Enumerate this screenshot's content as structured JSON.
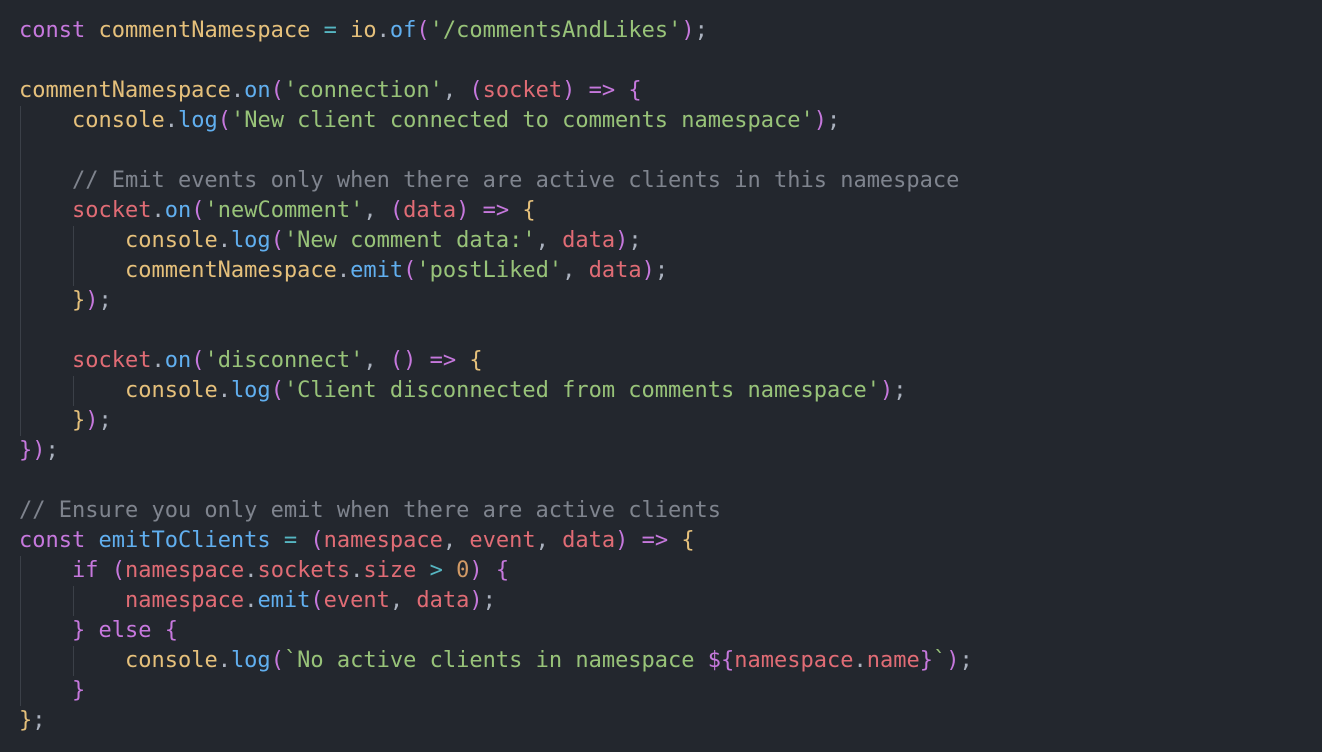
{
  "editor": {
    "language": "javascript",
    "lines": [
      {
        "indent": 0,
        "tokens": [
          [
            "keyword",
            "const"
          ],
          [
            "punct",
            " "
          ],
          [
            "ident",
            "commentNamespace"
          ],
          [
            "punct",
            " "
          ],
          [
            "op",
            "="
          ],
          [
            "punct",
            " "
          ],
          [
            "ident",
            "io"
          ],
          [
            "punct",
            "."
          ],
          [
            "func",
            "of"
          ],
          [
            "paren",
            "("
          ],
          [
            "string",
            "'/commentsAndLikes'"
          ],
          [
            "paren",
            ")"
          ],
          [
            "punct",
            ";"
          ]
        ]
      },
      {
        "indent": 0,
        "tokens": []
      },
      {
        "indent": 0,
        "tokens": [
          [
            "ident",
            "commentNamespace"
          ],
          [
            "punct",
            "."
          ],
          [
            "func",
            "on"
          ],
          [
            "paren",
            "("
          ],
          [
            "string",
            "'connection'"
          ],
          [
            "punct",
            ", "
          ],
          [
            "paren",
            "("
          ],
          [
            "param",
            "socket"
          ],
          [
            "paren",
            ")"
          ],
          [
            "punct",
            " "
          ],
          [
            "keyword",
            "=>"
          ],
          [
            "punct",
            " "
          ],
          [
            "brace",
            "{"
          ]
        ]
      },
      {
        "indent": 1,
        "tokens": [
          [
            "ident",
            "console"
          ],
          [
            "punct",
            "."
          ],
          [
            "func",
            "log"
          ],
          [
            "paren",
            "("
          ],
          [
            "string",
            "'New client connected to comments namespace'"
          ],
          [
            "paren",
            ")"
          ],
          [
            "punct",
            ";"
          ]
        ]
      },
      {
        "indent": 1,
        "tokens": []
      },
      {
        "indent": 1,
        "tokens": [
          [
            "comment",
            "// Emit events only when there are active clients in this namespace"
          ]
        ]
      },
      {
        "indent": 1,
        "tokens": [
          [
            "param",
            "socket"
          ],
          [
            "punct",
            "."
          ],
          [
            "func",
            "on"
          ],
          [
            "paren",
            "("
          ],
          [
            "string",
            "'newComment'"
          ],
          [
            "punct",
            ", "
          ],
          [
            "paren",
            "("
          ],
          [
            "param",
            "data"
          ],
          [
            "paren",
            ")"
          ],
          [
            "punct",
            " "
          ],
          [
            "keyword",
            "=>"
          ],
          [
            "punct",
            " "
          ],
          [
            "brace2",
            "{"
          ]
        ]
      },
      {
        "indent": 2,
        "tokens": [
          [
            "ident",
            "console"
          ],
          [
            "punct",
            "."
          ],
          [
            "func",
            "log"
          ],
          [
            "paren",
            "("
          ],
          [
            "string",
            "'New comment data:'"
          ],
          [
            "punct",
            ", "
          ],
          [
            "param",
            "data"
          ],
          [
            "paren",
            ")"
          ],
          [
            "punct",
            ";"
          ]
        ]
      },
      {
        "indent": 2,
        "tokens": [
          [
            "ident",
            "commentNamespace"
          ],
          [
            "punct",
            "."
          ],
          [
            "func",
            "emit"
          ],
          [
            "paren",
            "("
          ],
          [
            "string",
            "'postLiked'"
          ],
          [
            "punct",
            ", "
          ],
          [
            "param",
            "data"
          ],
          [
            "paren",
            ")"
          ],
          [
            "punct",
            ";"
          ]
        ]
      },
      {
        "indent": 1,
        "tokens": [
          [
            "brace2",
            "}"
          ],
          [
            "paren",
            ")"
          ],
          [
            "punct",
            ";"
          ]
        ]
      },
      {
        "indent": 1,
        "tokens": []
      },
      {
        "indent": 1,
        "tokens": [
          [
            "param",
            "socket"
          ],
          [
            "punct",
            "."
          ],
          [
            "func",
            "on"
          ],
          [
            "paren",
            "("
          ],
          [
            "string",
            "'disconnect'"
          ],
          [
            "punct",
            ", "
          ],
          [
            "paren",
            "()"
          ],
          [
            "punct",
            " "
          ],
          [
            "keyword",
            "=>"
          ],
          [
            "punct",
            " "
          ],
          [
            "brace2",
            "{"
          ]
        ]
      },
      {
        "indent": 2,
        "tokens": [
          [
            "ident",
            "console"
          ],
          [
            "punct",
            "."
          ],
          [
            "func",
            "log"
          ],
          [
            "paren",
            "("
          ],
          [
            "string",
            "'Client disconnected from comments namespace'"
          ],
          [
            "paren",
            ")"
          ],
          [
            "punct",
            ";"
          ]
        ]
      },
      {
        "indent": 1,
        "tokens": [
          [
            "brace2",
            "}"
          ],
          [
            "paren",
            ")"
          ],
          [
            "punct",
            ";"
          ]
        ]
      },
      {
        "indent": 0,
        "tokens": [
          [
            "brace",
            "}"
          ],
          [
            "paren",
            ")"
          ],
          [
            "punct",
            ";"
          ]
        ]
      },
      {
        "indent": 0,
        "tokens": []
      },
      {
        "indent": 0,
        "tokens": [
          [
            "comment",
            "// Ensure you only emit when there are active clients"
          ]
        ]
      },
      {
        "indent": 0,
        "tokens": [
          [
            "keyword",
            "const"
          ],
          [
            "punct",
            " "
          ],
          [
            "func",
            "emitToClients"
          ],
          [
            "punct",
            " "
          ],
          [
            "op",
            "="
          ],
          [
            "punct",
            " "
          ],
          [
            "paren",
            "("
          ],
          [
            "param",
            "namespace"
          ],
          [
            "punct",
            ", "
          ],
          [
            "param",
            "event"
          ],
          [
            "punct",
            ", "
          ],
          [
            "param",
            "data"
          ],
          [
            "paren",
            ")"
          ],
          [
            "punct",
            " "
          ],
          [
            "keyword",
            "=>"
          ],
          [
            "punct",
            " "
          ],
          [
            "brace2",
            "{"
          ]
        ]
      },
      {
        "indent": 1,
        "tokens": [
          [
            "keyword",
            "if"
          ],
          [
            "punct",
            " "
          ],
          [
            "paren",
            "("
          ],
          [
            "param",
            "namespace"
          ],
          [
            "punct",
            "."
          ],
          [
            "prop",
            "sockets"
          ],
          [
            "punct",
            "."
          ],
          [
            "prop",
            "size"
          ],
          [
            "punct",
            " "
          ],
          [
            "op",
            ">"
          ],
          [
            "punct",
            " "
          ],
          [
            "number",
            "0"
          ],
          [
            "paren",
            ")"
          ],
          [
            "punct",
            " "
          ],
          [
            "brace",
            "{"
          ]
        ]
      },
      {
        "indent": 2,
        "tokens": [
          [
            "param",
            "namespace"
          ],
          [
            "punct",
            "."
          ],
          [
            "func",
            "emit"
          ],
          [
            "paren",
            "("
          ],
          [
            "param",
            "event"
          ],
          [
            "punct",
            ", "
          ],
          [
            "param",
            "data"
          ],
          [
            "paren",
            ")"
          ],
          [
            "punct",
            ";"
          ]
        ]
      },
      {
        "indent": 1,
        "tokens": [
          [
            "brace",
            "}"
          ],
          [
            "punct",
            " "
          ],
          [
            "keyword",
            "else"
          ],
          [
            "punct",
            " "
          ],
          [
            "brace",
            "{"
          ]
        ]
      },
      {
        "indent": 2,
        "tokens": [
          [
            "ident",
            "console"
          ],
          [
            "punct",
            "."
          ],
          [
            "func",
            "log"
          ],
          [
            "paren",
            "("
          ],
          [
            "string",
            "`No active clients in namespace "
          ],
          [
            "keyword",
            "${"
          ],
          [
            "param",
            "namespace"
          ],
          [
            "punct",
            "."
          ],
          [
            "prop",
            "name"
          ],
          [
            "keyword",
            "}"
          ],
          [
            "string",
            "`"
          ],
          [
            "paren",
            ")"
          ],
          [
            "punct",
            ";"
          ]
        ]
      },
      {
        "indent": 1,
        "tokens": [
          [
            "brace",
            "}"
          ]
        ]
      },
      {
        "indent": 0,
        "tokens": [
          [
            "brace2",
            "}"
          ],
          [
            "punct",
            ";"
          ]
        ]
      }
    ]
  }
}
